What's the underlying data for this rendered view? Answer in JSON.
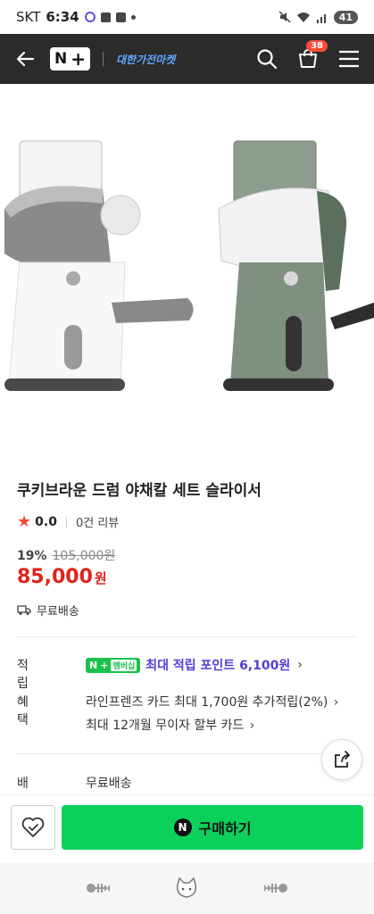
{
  "status_bar": {
    "carrier": "SKT",
    "time": "6:34",
    "battery": "41"
  },
  "nav": {
    "logo_text": "N",
    "logo_plus": "+",
    "store_name": "대한가전마켓",
    "cart_count": "38",
    "icons": [
      "back-arrow-icon",
      "search-icon",
      "cart-icon",
      "menu-icon"
    ]
  },
  "product": {
    "title": "쿠키브라운 드럼 야채칼 세트 슬라이서",
    "rating": "0.0",
    "review_count": "0건 리뷰",
    "discount": "19%",
    "original_price": "105,000원",
    "price": "85,000",
    "price_unit": "원",
    "shipping": "무료배송"
  },
  "info": {
    "points_label": "적립",
    "membership_badge": "멤버십",
    "points_text": "최대 적립 포인트 6,100원",
    "benefits_label": "혜택",
    "benefit_1": "라인프렌즈 카드 최대 1,700원 추가적립(2%)",
    "benefit_2": "최대 12개월 무이자 할부 카드",
    "delivery_label": "배송",
    "delivery_value": "무료배송"
  },
  "buy_bar": {
    "buy_label": "구매하기",
    "buy_icon_text": "N"
  },
  "colors": {
    "price_red": "#e0231c",
    "buy_green": "#0bd15b",
    "point_purple": "#5a3bd6",
    "nav_bg": "#2b2b2b"
  }
}
